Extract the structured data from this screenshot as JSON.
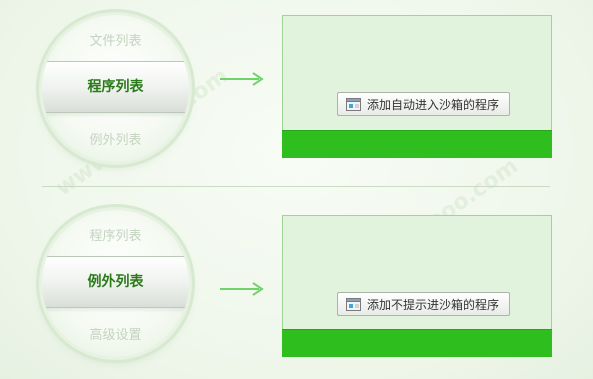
{
  "top": {
    "menu": {
      "prev": "文件列表",
      "selected": "程序列表",
      "next": "例外列表"
    },
    "button": {
      "label": "添加自动进入沙箱的程序",
      "icon": "add-program-icon"
    }
  },
  "bottom": {
    "menu": {
      "prev": "程序列表",
      "selected": "例外列表",
      "next": "高级设置"
    },
    "button": {
      "label": "添加不提示进沙箱的程序",
      "icon": "add-program-icon"
    }
  },
  "colors": {
    "accent_green": "#2ebf1f",
    "window_fill": "#e1f3dc",
    "selected_text": "#2a7a1a",
    "arrow": "#6fd36a"
  },
  "watermark": {
    "text": "www.ddooo.com"
  }
}
